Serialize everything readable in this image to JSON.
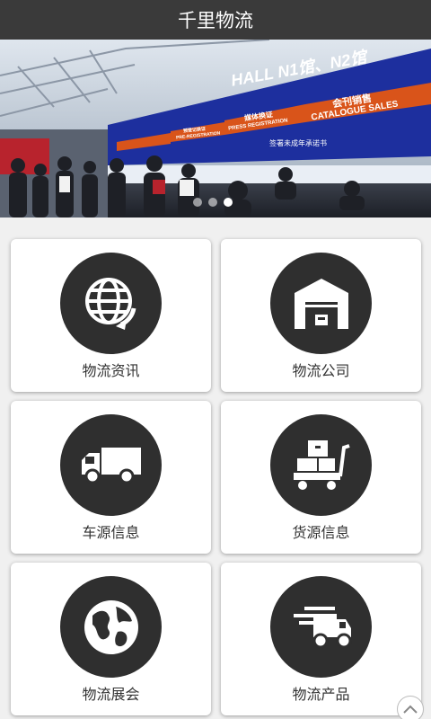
{
  "header": {
    "title": "千里物流"
  },
  "banner": {
    "hall_sign": "HALL N1馆、N2馆",
    "sign_catalogue_cn": "会刊销售",
    "sign_catalogue_en": "CATALOGUE SALES",
    "sign_press_cn": "媒体换证",
    "sign_press_en": "PRESS REGISTRATION",
    "sign_pre_cn": "预登记换证",
    "sign_pre_en": "PRE-REGISTRATION",
    "counter_sign": "签署未成年承诺书",
    "slides": 3,
    "active_slide": 0
  },
  "menu": [
    {
      "label": "物流资讯",
      "icon": "globe-refresh-icon"
    },
    {
      "label": "物流公司",
      "icon": "warehouse-icon"
    },
    {
      "label": "车源信息",
      "icon": "truck-icon"
    },
    {
      "label": "货源信息",
      "icon": "cargo-cart-icon"
    },
    {
      "label": "物流展会",
      "icon": "earth-icon"
    },
    {
      "label": "物流产品",
      "icon": "fast-delivery-icon"
    }
  ],
  "colors": {
    "topbar": "#3a3a3a",
    "icon_circle": "#2f2f2f",
    "banner_blue": "#1d2f9e",
    "banner_orange": "#d9541a"
  }
}
